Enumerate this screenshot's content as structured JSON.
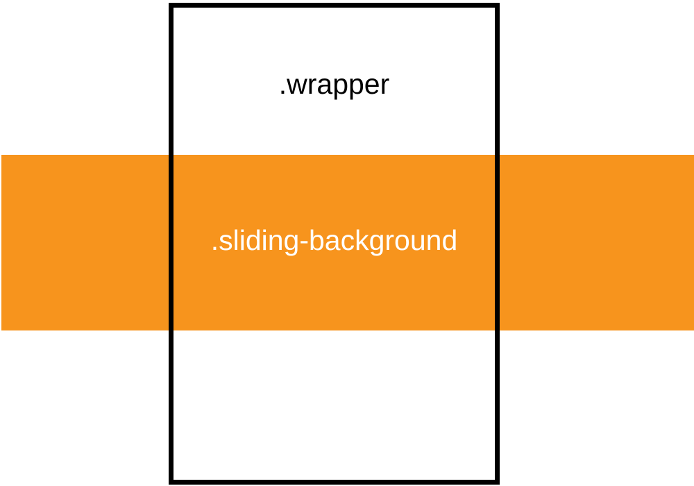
{
  "labels": {
    "wrapper": ".wrapper",
    "sliding_background": ".sliding-background"
  },
  "colors": {
    "page_background": "#ffffff",
    "sliding_background_fill": "#f7941d",
    "wrapper_border": "#000000",
    "wrapper_label": "#000000",
    "sliding_background_label": "#ffffff"
  }
}
